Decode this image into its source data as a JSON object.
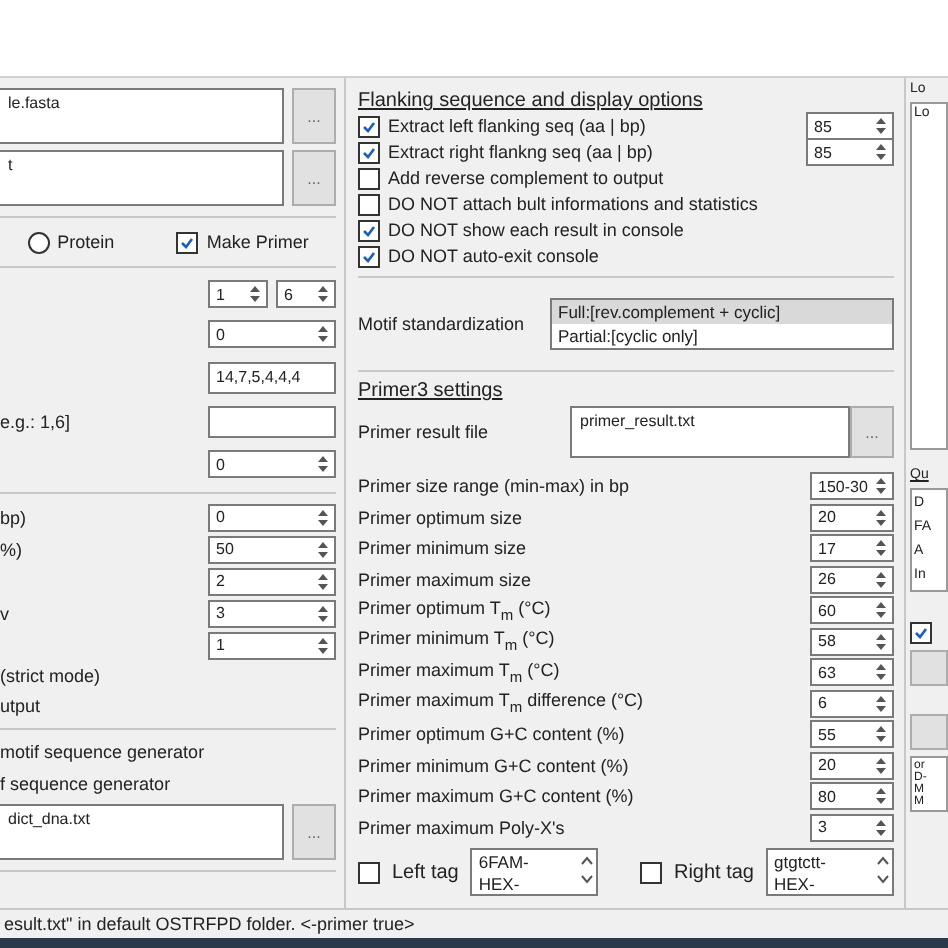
{
  "left": {
    "sections": [
      {
        "items": [
          {
            "kind": "file",
            "value": "le.fasta",
            "button": "..."
          },
          {
            "kind": "file",
            "value": "t",
            "button": "..."
          }
        ]
      },
      {
        "items": [
          {
            "kind": "options",
            "radio": {
              "label": "Protein",
              "selected": false
            },
            "checkbox": {
              "label": "Make Primer",
              "checked": true
            }
          }
        ]
      },
      {
        "items": [
          {
            "kind": "spinner_pair",
            "values": [
              "1",
              "6"
            ]
          },
          {
            "kind": "spinner",
            "value": "0"
          },
          {
            "kind": "text",
            "value": "14,7,5,4,4,4"
          },
          {
            "kind": "text",
            "label": "e.g.: 1,6]"
          },
          {
            "kind": "spinner",
            "value": "0"
          }
        ]
      },
      {
        "items": [
          {
            "kind": "spinner",
            "label": "bp)",
            "value": "0"
          },
          {
            "kind": "spinner",
            "label": "%)",
            "value": "50"
          },
          {
            "kind": "spinner",
            "value": "2"
          },
          {
            "kind": "spinner",
            "label": "v",
            "value": "3"
          },
          {
            "kind": "spinner",
            "value": "1"
          },
          {
            "kind": "label",
            "text": "(strict mode)"
          },
          {
            "kind": "label",
            "text": "utput"
          }
        ]
      },
      {
        "items": [
          {
            "kind": "label",
            "text": "motif sequence generator"
          },
          {
            "kind": "label",
            "text": "f sequence generator"
          },
          {
            "kind": "file",
            "value": "dict_dna.txt",
            "button": "..."
          }
        ]
      }
    ]
  },
  "flanking": {
    "title": "Flanking sequence and display options",
    "options": [
      {
        "label": "Extract left flanking seq  (aa | bp)",
        "checked": true,
        "value": "85"
      },
      {
        "label": "Extract right flankng seq (aa | bp)",
        "checked": true,
        "value": "85"
      },
      {
        "label": "Add reverse complement to output",
        "checked": false
      },
      {
        "label": "DO NOT attach bult informations and statistics",
        "checked": false
      },
      {
        "label": "DO NOT show each result in console",
        "checked": true
      },
      {
        "label": "DO NOT auto-exit console",
        "checked": true
      }
    ]
  },
  "motif": {
    "label": "Motif standardization",
    "options": [
      {
        "label": "Full:[rev.complement + cyclic]",
        "selected": true
      },
      {
        "label": "Partial:[cyclic only]",
        "selected": false
      }
    ]
  },
  "primer3": {
    "title": "Primer3 settings",
    "result_file": {
      "label": "Primer result file",
      "value": "primer_result.txt",
      "button": "..."
    },
    "params": [
      {
        "label": "Primer size range (min-max) in bp",
        "value": "150-30"
      },
      {
        "label": "Primer optimum size",
        "value": "20"
      },
      {
        "label": "Primer minimum size",
        "value": "17"
      },
      {
        "label": "Primer maximum size",
        "value": "26"
      },
      {
        "label": "Primer optimum T$_{m}$ (°C)",
        "value": "60"
      },
      {
        "label": "Primer minimum T$_{m}$ (°C)",
        "value": "58"
      },
      {
        "label": "Primer maximum T$_{m}$ (°C)",
        "value": "63"
      },
      {
        "label": "Primer maximum T$_{m}$ difference (°C)",
        "value": "6"
      },
      {
        "label": "Primer optimum G+C content (%)",
        "value": "55"
      },
      {
        "label": "Primer minimum G+C content (%)",
        "value": "20"
      },
      {
        "label": "Primer maximum G+C content (%)",
        "value": "80"
      },
      {
        "label": "Primer maximum Poly-X's",
        "value": "3"
      }
    ],
    "tags": [
      {
        "label": "Left tag",
        "checked": false,
        "options": [
          "6FAM-",
          "HEX-"
        ]
      },
      {
        "label": "Right tag",
        "checked": false,
        "options": [
          "gtgtctt-",
          "HEX-"
        ]
      }
    ]
  },
  "right": {
    "log_label": "Lo",
    "log_text": "Lo",
    "queue_label": "Qu",
    "queue_items": [
      "D",
      "FA",
      "A",
      "In"
    ],
    "checkbox": {
      "checked": true
    },
    "info_lines": [
      "or",
      "D-",
      "M",
      "M"
    ]
  },
  "status_bar": "esult.txt\" in default OSTRFPD folder. <-primer true>"
}
